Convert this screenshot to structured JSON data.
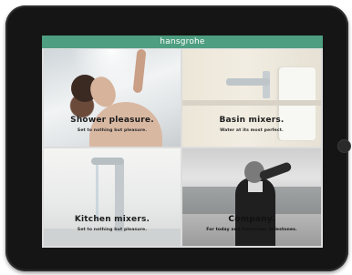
{
  "app": {
    "logo": "hansgrohe"
  },
  "tiles": [
    {
      "title": "Shower pleasure.",
      "subtitle": "Set to nothing but pleasure."
    },
    {
      "title": "Basin mixers.",
      "subtitle": "Water at its most perfect."
    },
    {
      "title": "Kitchen mixers.",
      "subtitle": "Set to nothing but pleasure."
    },
    {
      "title": "Company.",
      "subtitle": "For today and tomorrow: milestones."
    }
  ],
  "colors": {
    "brand_bar": "#4e9e81",
    "device_frame": "#151515"
  }
}
